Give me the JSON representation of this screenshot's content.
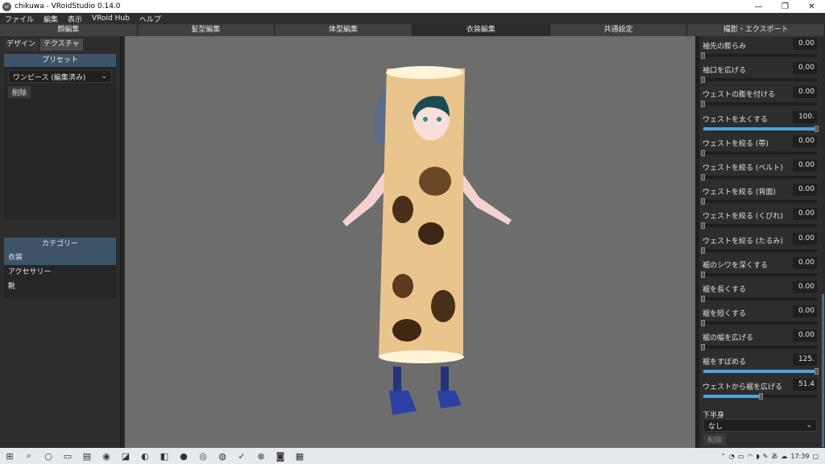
{
  "window": {
    "title": "chikuwa - VRoidStudio 0.14.0",
    "app_icon": "vr"
  },
  "menu": [
    "ファイル",
    "編集",
    "表示",
    "VRoid Hub",
    "ヘルプ"
  ],
  "tabs": [
    "顔編集",
    "髪型編集",
    "体型編集",
    "衣装編集",
    "共通設定",
    "撮影・エクスポート"
  ],
  "active_tab_index": 3,
  "left": {
    "subtabs": [
      "デザイン",
      "テクスチャ"
    ],
    "preset_title": "プリセット",
    "preset_value": "ワンピース (編集済み)",
    "delete_label": "削除",
    "category_title": "カテゴリー",
    "categories": [
      "衣装",
      "アクセサリー",
      "靴"
    ]
  },
  "params": [
    {
      "label": "袖先の膨らみ",
      "value": "0.00",
      "level": 0
    },
    {
      "label": "袖口を広げる",
      "value": "0.00",
      "level": 0
    },
    {
      "label": "ウェストの膨を付ける",
      "value": "0.00",
      "level": 0
    },
    {
      "label": "ウェストを太くする",
      "value": "100.",
      "level": 1
    },
    {
      "label": "ウェストを絞る (帯)",
      "value": "0.00",
      "level": 0
    },
    {
      "label": "ウェストを絞る (ベルト)",
      "value": "0.00",
      "level": 0
    },
    {
      "label": "ウェストを絞る (背面)",
      "value": "0.00",
      "level": 0
    },
    {
      "label": "ウェストを絞る (くびれ)",
      "value": "0.00",
      "level": 0
    },
    {
      "label": "ウェストを絞る (たるみ)",
      "value": "0.00",
      "level": 0
    },
    {
      "label": "裾のシワを深くする",
      "value": "0.00",
      "level": 0
    },
    {
      "label": "裾を長くする",
      "value": "0.00",
      "level": 0
    },
    {
      "label": "裾を短くする",
      "value": "0.00",
      "level": 0
    },
    {
      "label": "裾の幅を広げる",
      "value": "0.00",
      "level": 0
    },
    {
      "label": "裾をすぼめる",
      "value": "125.",
      "level": 1
    },
    {
      "label": "ウェストから裾を広げる",
      "value": "51.4",
      "level": 0.514
    }
  ],
  "lower": {
    "label": "下半身",
    "value": "なし",
    "delete_label": "削除"
  },
  "taskbar": {
    "time": "17:39"
  }
}
